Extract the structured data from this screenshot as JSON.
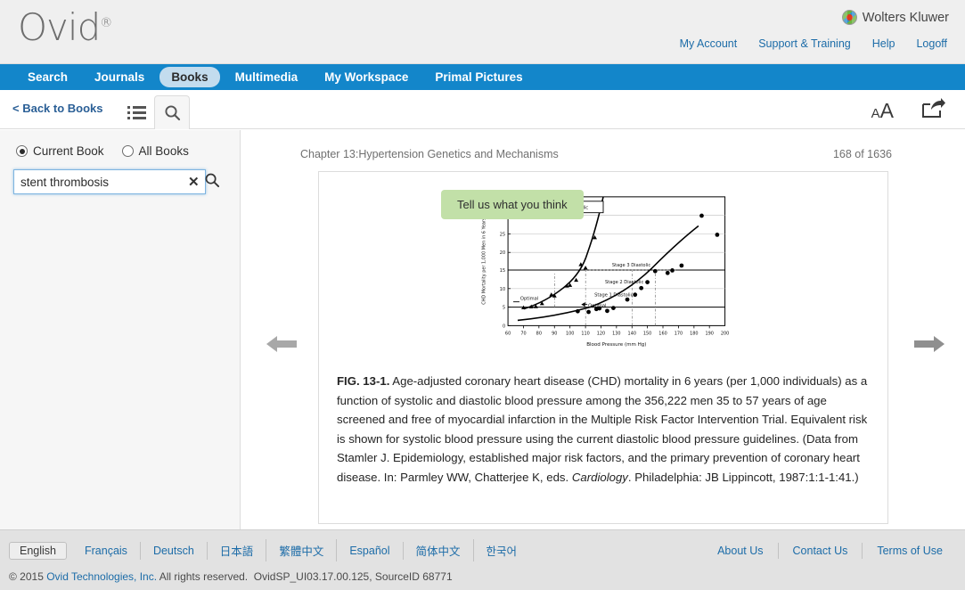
{
  "header": {
    "logo_text": "Ovid",
    "logo_sup": "®",
    "brand": "Wolters Kluwer",
    "brand_icon": "wolters-kluwer-globe-icon",
    "links": [
      {
        "label": "My Account"
      },
      {
        "label": "Support & Training"
      },
      {
        "label": "Help"
      },
      {
        "label": "Logoff"
      }
    ]
  },
  "nav": {
    "items": [
      {
        "label": "Search",
        "active": false
      },
      {
        "label": "Journals",
        "active": false
      },
      {
        "label": "Books",
        "active": true
      },
      {
        "label": "Multimedia",
        "active": false
      },
      {
        "label": "My Workspace",
        "active": false
      },
      {
        "label": "Primal Pictures",
        "active": false
      }
    ]
  },
  "toolbar": {
    "back_label": "< Back to Books",
    "toc_tab_icon": "list-icon",
    "search_tab_icon": "search-icon",
    "feedback_label": "Tell us what you think",
    "font_size_icon": "font-size-icon",
    "font_size_small": "A",
    "font_size_large": "A",
    "share_icon": "share-icon"
  },
  "sidebar": {
    "scope": {
      "current_book_label": "Current Book",
      "all_books_label": "All Books",
      "selected": "Current Book"
    },
    "search": {
      "value": "stent thrombosis",
      "placeholder": "",
      "clear_icon": "close-icon",
      "submit_icon": "search-icon"
    }
  },
  "reader": {
    "chapter_title": "Chapter 13:Hypertension Genetics and Mechanisms",
    "page_indicator": "168 of 1636",
    "prev_icon": "arrow-left-icon",
    "next_icon": "arrow-right-icon",
    "figure_label": "FIG. 13-1.",
    "caption_part1": " Age-adjusted coronary heart disease (CHD) mortality in 6 years (per 1,000 individuals) as a function of systolic and diastolic blood pressure among the 356,222 men 35 to 57 years of age screened and free of myocardial infarction in the Multiple Risk Factor Intervention Trial. Equivalent risk is shown for systolic blood pressure using the current diastolic blood pressure guidelines. (Data from Stamler J. Epidemiology, established major risk factors, and the primary prevention of coronary heart disease. In: Parmley WW, Chatterjee K, eds. ",
    "caption_italic": "Cardiology",
    "caption_part2": ". Philadelphia: JB Lippincott, 1987:1:1-1:41.)"
  },
  "chart_data": {
    "type": "scatter",
    "title": "",
    "xlabel": "Blood Pressure (mm Hg)",
    "ylabel": "CHD Mortality per 1,000 Men in 6 Years",
    "xlim": [
      60,
      200
    ],
    "ylim": [
      0,
      35
    ],
    "xticks": [
      60,
      70,
      80,
      90,
      100,
      110,
      120,
      130,
      140,
      150,
      160,
      170,
      180,
      190,
      200
    ],
    "yticks": [
      0,
      5,
      10,
      15,
      20,
      25,
      30,
      35
    ],
    "grid": true,
    "legend_position": "top-left",
    "series": [
      {
        "name": "Diastolic",
        "marker": "triangle",
        "points": [
          [
            70,
            4.6
          ],
          [
            75,
            4.9
          ],
          [
            78,
            5.0
          ],
          [
            82,
            5.8
          ],
          [
            88,
            8.2
          ],
          [
            90,
            7.9
          ],
          [
            98,
            10.6
          ],
          [
            100,
            10.8
          ],
          [
            104,
            12.2
          ],
          [
            107,
            16.2
          ],
          [
            110,
            15.3
          ],
          [
            116,
            23.5
          ]
        ]
      },
      {
        "name": "Systolic",
        "marker": "circle",
        "points": [
          [
            105,
            3.9
          ],
          [
            112,
            3.7
          ],
          [
            117,
            4.5
          ],
          [
            119,
            4.7
          ],
          [
            124,
            4.0
          ],
          [
            128,
            4.8
          ],
          [
            137,
            7.1
          ],
          [
            142,
            8.4
          ],
          [
            146,
            10.2
          ],
          [
            150,
            11.8
          ],
          [
            155,
            14.8
          ],
          [
            163,
            14.3
          ],
          [
            166,
            15.0
          ],
          [
            172,
            16.3
          ],
          [
            185,
            30.4
          ],
          [
            195,
            25.0
          ]
        ]
      }
    ],
    "annotations": [
      {
        "text": "Stage 3 Diastolic",
        "x": 140,
        "y": 16.5
      },
      {
        "text": "Stage 2 Diastolic",
        "x": 135,
        "y": 12.5
      },
      {
        "text": "Stage 1 Diastolic",
        "x": 128,
        "y": 9.0
      },
      {
        "text": "Optimal",
        "x": 72,
        "y": 6.3
      },
      {
        "text": "Optimal",
        "x": 117,
        "y": 5.6
      }
    ],
    "reference_lines_y": [
      5,
      15
    ],
    "reference_lines_x": [
      90,
      110,
      140,
      155,
      165
    ]
  },
  "footer": {
    "languages": [
      {
        "label": "English",
        "active": true
      },
      {
        "label": "Français",
        "active": false
      },
      {
        "label": "Deutsch",
        "active": false
      },
      {
        "label": "日本語",
        "active": false
      },
      {
        "label": "繁體中文",
        "active": false
      },
      {
        "label": "Español",
        "active": false
      },
      {
        "label": "简体中文",
        "active": false
      },
      {
        "label": "한국어",
        "active": false
      }
    ],
    "copyright_prefix": "© 2015 ",
    "copyright_link": "Ovid Technologies, Inc.",
    "copyright_suffix": " All rights reserved.",
    "build": "OvidSP_UI03.17.00.125, SourceID 68771",
    "links": [
      {
        "label": "About Us"
      },
      {
        "label": "Contact Us"
      },
      {
        "label": "Terms of Use"
      }
    ]
  }
}
